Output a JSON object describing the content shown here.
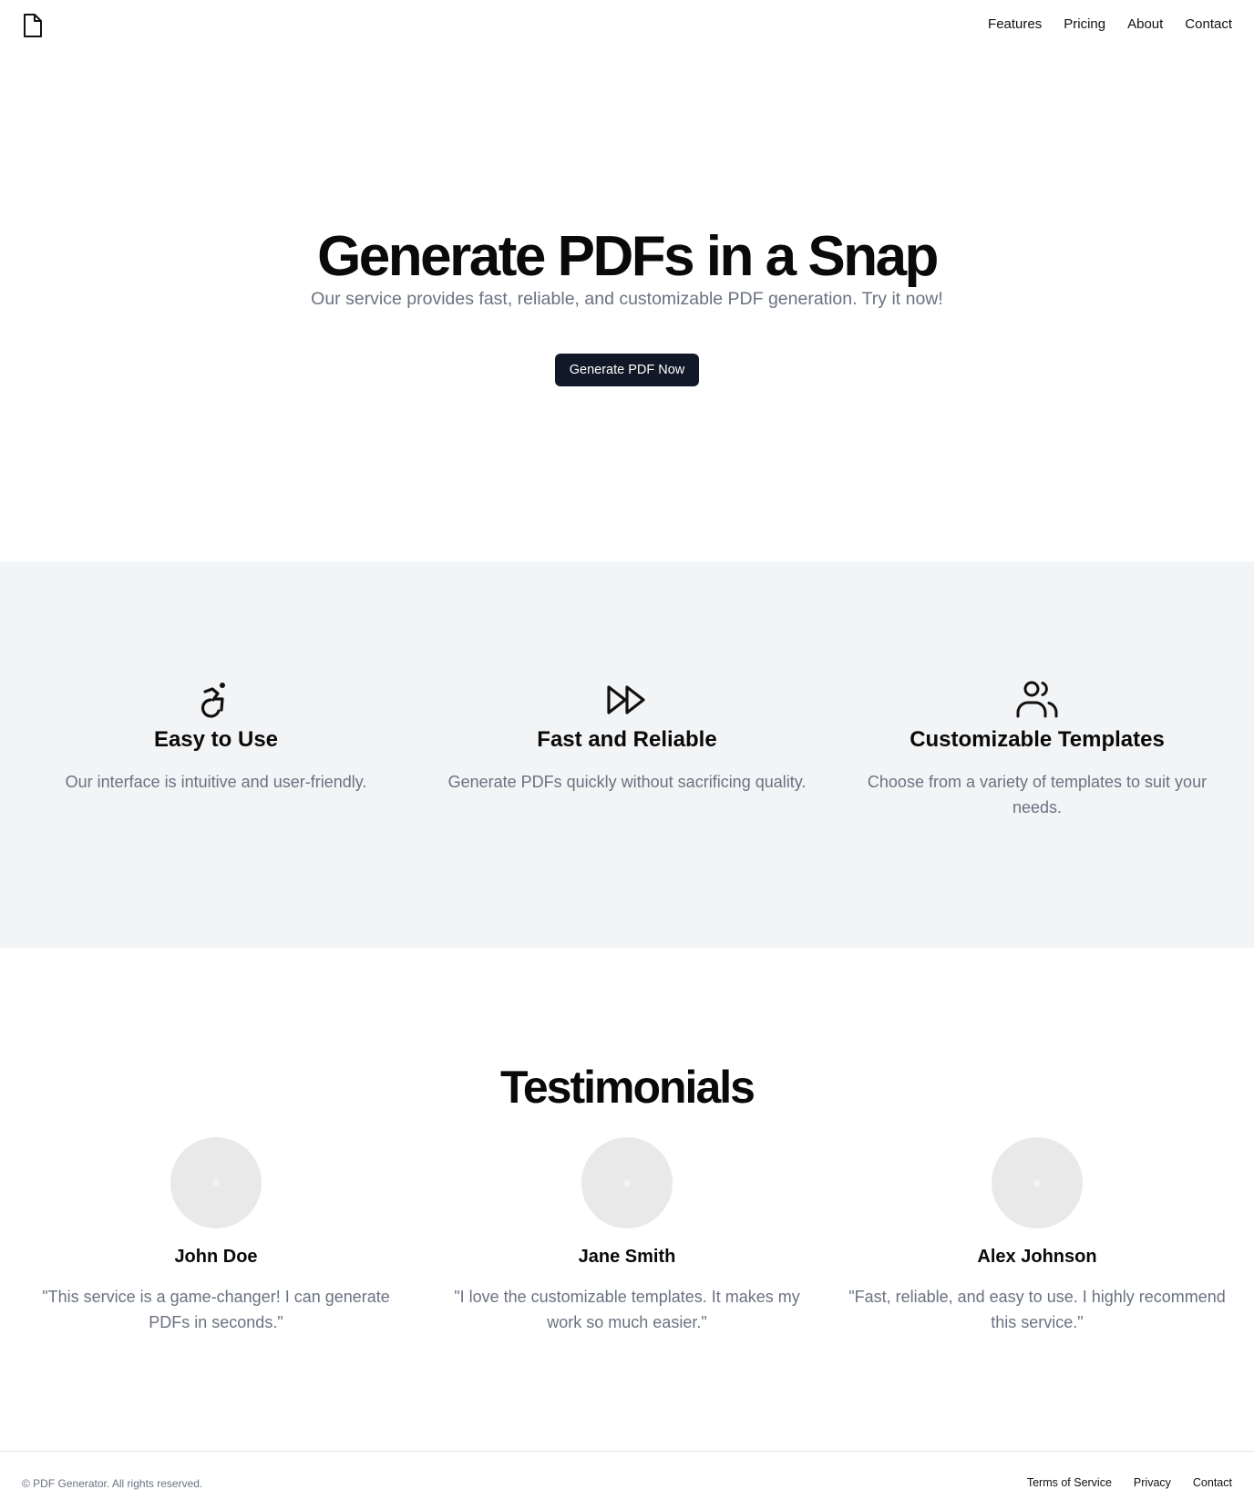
{
  "header": {
    "logo_icon": "file-icon",
    "nav": [
      {
        "label": "Features"
      },
      {
        "label": "Pricing"
      },
      {
        "label": "About"
      },
      {
        "label": "Contact"
      }
    ]
  },
  "hero": {
    "title": "Generate PDFs in a Snap",
    "subtitle": "Our service provides fast, reliable, and customizable PDF generation. Try it now!",
    "cta_label": "Generate PDF Now"
  },
  "features": [
    {
      "icon": "accessibility-icon",
      "title": "Easy to Use",
      "description": "Our interface is intuitive and user-friendly."
    },
    {
      "icon": "fast-forward-icon",
      "title": "Fast and Reliable",
      "description": "Generate PDFs quickly without sacrificing quality."
    },
    {
      "icon": "users-icon",
      "title": "Customizable Templates",
      "description": "Choose from a variety of templates to suit your needs."
    }
  ],
  "testimonials": {
    "heading": "Testimonials",
    "items": [
      {
        "name": "John Doe",
        "quote": "\"This service is a game-changer! I can generate PDFs in seconds.\""
      },
      {
        "name": "Jane Smith",
        "quote": "\"I love the customizable templates. It makes my work so much easier.\""
      },
      {
        "name": "Alex Johnson",
        "quote": "\"Fast, reliable, and easy to use. I highly recommend this service.\""
      }
    ]
  },
  "footer": {
    "copyright": "© PDF Generator. All rights reserved.",
    "links": [
      {
        "label": "Terms of Service"
      },
      {
        "label": "Privacy"
      },
      {
        "label": "Contact"
      }
    ]
  },
  "colors": {
    "primary_button": "#111827",
    "muted_text": "#6b7280",
    "section_bg": "#f3f4f6"
  }
}
